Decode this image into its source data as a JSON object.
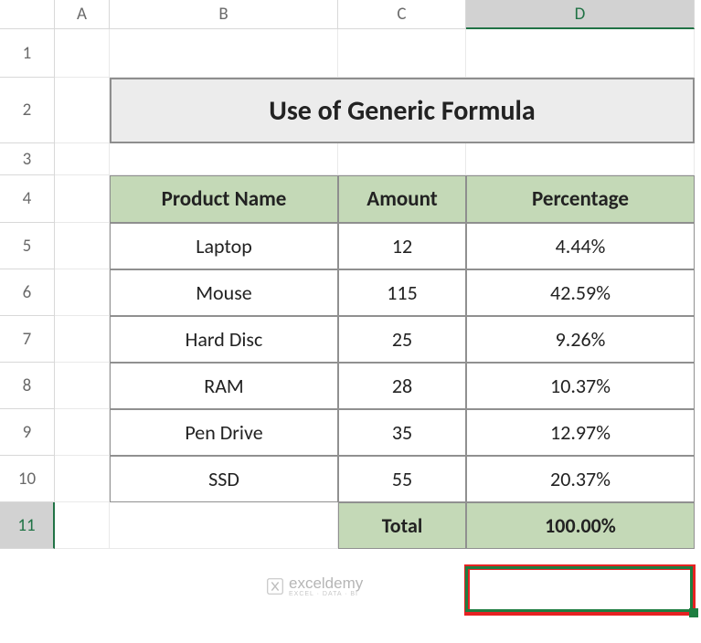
{
  "columns": [
    "A",
    "B",
    "C",
    "D"
  ],
  "rows": [
    "1",
    "2",
    "3",
    "4",
    "5",
    "6",
    "7",
    "8",
    "9",
    "10",
    "11"
  ],
  "title": "Use of Generic Formula",
  "headers": {
    "product": "Product Name",
    "amount": "Amount",
    "percentage": "Percentage"
  },
  "data": [
    {
      "product": "Laptop",
      "amount": "12",
      "percentage": "4.44%"
    },
    {
      "product": "Mouse",
      "amount": "115",
      "percentage": "42.59%"
    },
    {
      "product": "Hard Disc",
      "amount": "25",
      "percentage": "9.26%"
    },
    {
      "product": "RAM",
      "amount": "28",
      "percentage": "10.37%"
    },
    {
      "product": "Pen Drive",
      "amount": "35",
      "percentage": "12.97%"
    },
    {
      "product": "SSD",
      "amount": "55",
      "percentage": "20.37%"
    }
  ],
  "total": {
    "label": "Total",
    "value": "100.00%"
  },
  "watermark": {
    "name": "exceldemy",
    "sub": "EXCEL · DATA · BI"
  },
  "chart_data": {
    "type": "table",
    "columns": [
      "Product Name",
      "Amount",
      "Percentage"
    ],
    "rows": [
      [
        "Laptop",
        12,
        "4.44%"
      ],
      [
        "Mouse",
        115,
        "42.59%"
      ],
      [
        "Hard Disc",
        25,
        "9.26%"
      ],
      [
        "RAM",
        28,
        "10.37%"
      ],
      [
        "Pen Drive",
        35,
        "12.97%"
      ],
      [
        "SSD",
        55,
        "20.37%"
      ]
    ],
    "total_row": [
      "Total",
      null,
      "100.00%"
    ],
    "title": "Use of Generic Formula"
  }
}
